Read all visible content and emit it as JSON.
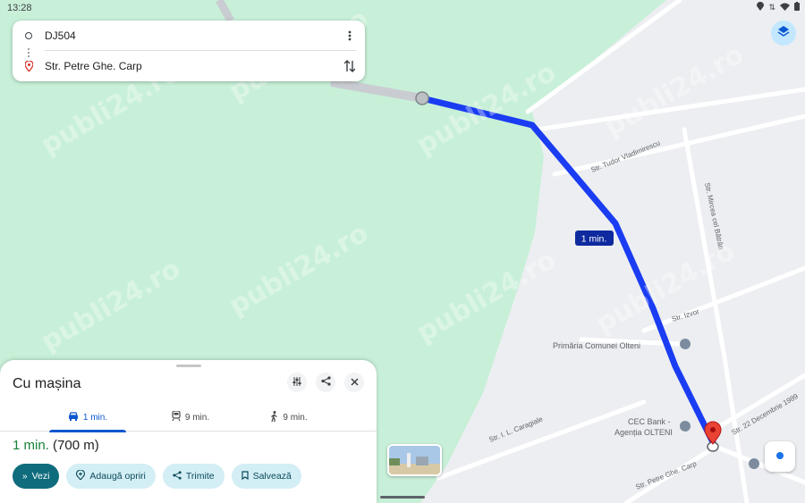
{
  "status_bar": {
    "time": "13:28"
  },
  "directions": {
    "origin": "DJ504",
    "destination": "Str. Petre Ghe. Carp"
  },
  "map": {
    "route_badge": "1 min.",
    "streets": [
      "Str. Tudor Vladimirescu",
      "Str. Mircea cel Bătrân",
      "Str. Izvor",
      "Str. I. L. Caragiale",
      "Str. 22 Decembrie 1989",
      "Str. Petre Ghe. Carp"
    ],
    "pois": [
      "Primăria Comunei Olteni",
      "CEC Bank -",
      "Agenția OLTENI"
    ],
    "route_color": "#1a3cf2",
    "park_color": "#c8f0d8"
  },
  "sheet": {
    "title": "Cu mașina",
    "tabs": [
      {
        "label": "1 min.",
        "icon": "car-icon"
      },
      {
        "label": "9 min.",
        "icon": "train-icon"
      },
      {
        "label": "9 min.",
        "icon": "walk-icon"
      }
    ],
    "duration": "1 min.",
    "distance": "(700 m)",
    "buttons": {
      "go": "Vezi",
      "add_stops": "Adaugă opriri",
      "share": "Trimite",
      "save": "Salvează"
    }
  },
  "watermark": "publi24.ro"
}
